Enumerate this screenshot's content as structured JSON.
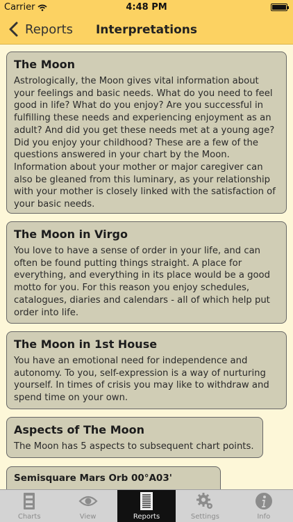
{
  "status": {
    "carrier": "Carrier",
    "time": "4:48 PM"
  },
  "nav": {
    "back_label": "Reports",
    "title": "Interpretations"
  },
  "cards": [
    {
      "title": "The Moon",
      "text": "Astrologically, the Moon gives vital information about your feelings and basic needs. What do you need to feel good in life? What do you enjoy? Are you successful in fulfilling these needs and experiencing enjoyment as an adult? And did you get these needs met at a young age? Did you enjoy your childhood? These are a few of the questions answered in your chart by the Moon. Information about your mother or major caregiver can also be gleaned from this luminary, as your relationship with your mother is closely linked with the satisfaction of your basic needs."
    },
    {
      "title": "The Moon in Virgo",
      "text": "You love to have a sense of order in your life, and can often be found putting things straight. A place for everything, and everything in its place would be a good motto for you. For this reason you enjoy schedules, catalogues, diaries and calendars - all of which help put order into life."
    },
    {
      "title": "The Moon in 1st House",
      "text": "You have an emotional need for independence and autonomy. To you, self-expression is a way of nurturing yourself. In times of crisis you may like to withdraw and spend time on your own."
    },
    {
      "title": "Aspects of The Moon",
      "text": "The Moon has 5 aspects to subsequent chart points."
    },
    {
      "title": "Semisquare Mars Orb 00°A03'",
      "text": ""
    }
  ],
  "tabs": [
    {
      "label": "Charts",
      "icon": "charts-icon",
      "active": false
    },
    {
      "label": "View",
      "icon": "eye-icon",
      "active": false
    },
    {
      "label": "Reports",
      "icon": "reports-icon",
      "active": true
    },
    {
      "label": "Settings",
      "icon": "gear-icon",
      "active": false
    },
    {
      "label": "Info",
      "icon": "info-icon",
      "active": false
    }
  ],
  "colors": {
    "nav_bg": "#fcd262",
    "page_bg": "#fdf7d8",
    "card_bg": "#d0cdb5",
    "tab_active_bg": "#111111"
  }
}
